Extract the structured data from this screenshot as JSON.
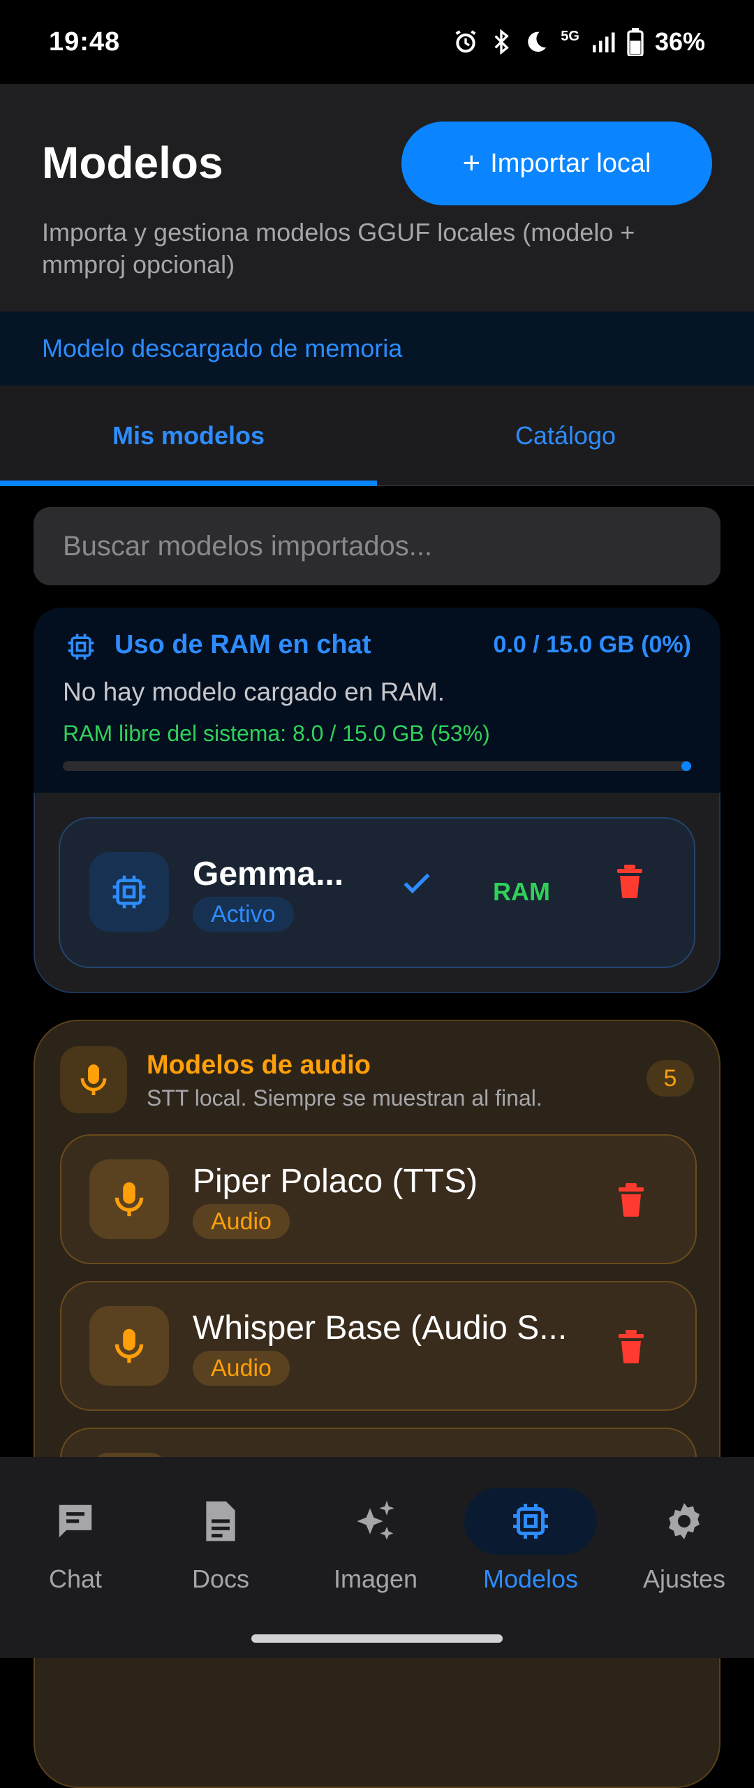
{
  "status_bar": {
    "time": "19:48",
    "network": "5G",
    "battery": "36%"
  },
  "header": {
    "title": "Modelos",
    "import_button": "Importar local",
    "import_icon": "+",
    "subtitle": "Importa y gestiona modelos GGUF locales (modelo + mmproj opcional)"
  },
  "notice": "Modelo descargado de memoria",
  "tabs": [
    {
      "label": "Mis modelos",
      "active": true
    },
    {
      "label": "Catálogo",
      "active": false
    }
  ],
  "search": {
    "placeholder": "Buscar modelos importados..."
  },
  "ram_panel": {
    "title": "Uso de RAM en chat",
    "value": "0.0 / 15.0 GB (0%)",
    "status": "No hay modelo cargado en RAM.",
    "system_free": "RAM libre del sistema: 8.0 / 15.0 GB (53%)",
    "usage_fraction": 0
  },
  "models": [
    {
      "name": "Gemma...",
      "badge": "Activo",
      "location": "RAM",
      "icon": "chip-icon"
    }
  ],
  "audio_section": {
    "title": "Modelos de audio",
    "subtitle": "STT local. Siempre se muestran al final.",
    "count": "5",
    "items": [
      {
        "name": "Piper Polaco (TTS)",
        "badge": "Audio"
      },
      {
        "name": "Whisper Base (Audio S...",
        "badge": "Audio"
      }
    ]
  },
  "bottom_nav": [
    {
      "label": "Chat",
      "icon": "chat-icon",
      "active": false
    },
    {
      "label": "Docs",
      "icon": "document-icon",
      "active": false
    },
    {
      "label": "Imagen",
      "icon": "sparkle-icon",
      "active": false
    },
    {
      "label": "Modelos",
      "icon": "chip-icon",
      "active": true
    },
    {
      "label": "Ajustes",
      "icon": "gear-icon",
      "active": false
    }
  ],
  "colors": {
    "accent": "#0a84ff",
    "ram_ok": "#30d158",
    "audio": "#ff9f0a",
    "danger": "#ff3b30"
  }
}
